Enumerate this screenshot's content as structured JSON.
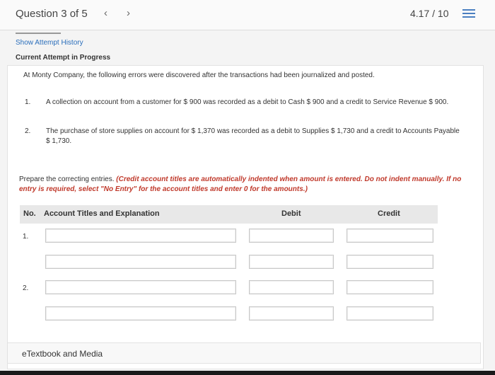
{
  "header": {
    "question_label": "Question 3 of 5",
    "prev_icon": "chevron-left",
    "next_icon": "chevron-right",
    "score": "4.17 / 10",
    "list_icon": "list"
  },
  "attempt": {
    "show_history": "Show Attempt History",
    "status": "Current Attempt in Progress"
  },
  "problem": {
    "intro": "At Monty Company, the following errors were discovered after the transactions had been journalized and posted.",
    "items": [
      {
        "num": "1.",
        "text": "A collection on account from a customer for $ 900 was recorded as a debit to Cash $ 900 and a credit to Service Revenue $ 900."
      },
      {
        "num": "2.",
        "text": "The purchase of store supplies on account for $ 1,370 was recorded as a debit to Supplies $ 1,730 and a credit to Accounts Payable $ 1,730."
      }
    ],
    "instruction_plain": "Prepare the correcting entries. ",
    "instruction_red": "(Credit account titles are automatically indented when amount is entered. Do not indent manually. If no entry is required, select \"No Entry\" for the account titles and enter 0 for the amounts.)"
  },
  "table": {
    "headers": {
      "no": "No.",
      "account": "Account Titles and Explanation",
      "debit": "Debit",
      "credit": "Credit"
    },
    "entries": [
      {
        "no": "1.",
        "rows": [
          {
            "account": "",
            "debit": "",
            "credit": ""
          },
          {
            "account": "",
            "debit": "",
            "credit": ""
          }
        ]
      },
      {
        "no": "2.",
        "rows": [
          {
            "account": "",
            "debit": "",
            "credit": ""
          },
          {
            "account": "",
            "debit": "",
            "credit": ""
          }
        ]
      }
    ]
  },
  "footer": {
    "etextbook_label": "eTextbook and Media"
  }
}
